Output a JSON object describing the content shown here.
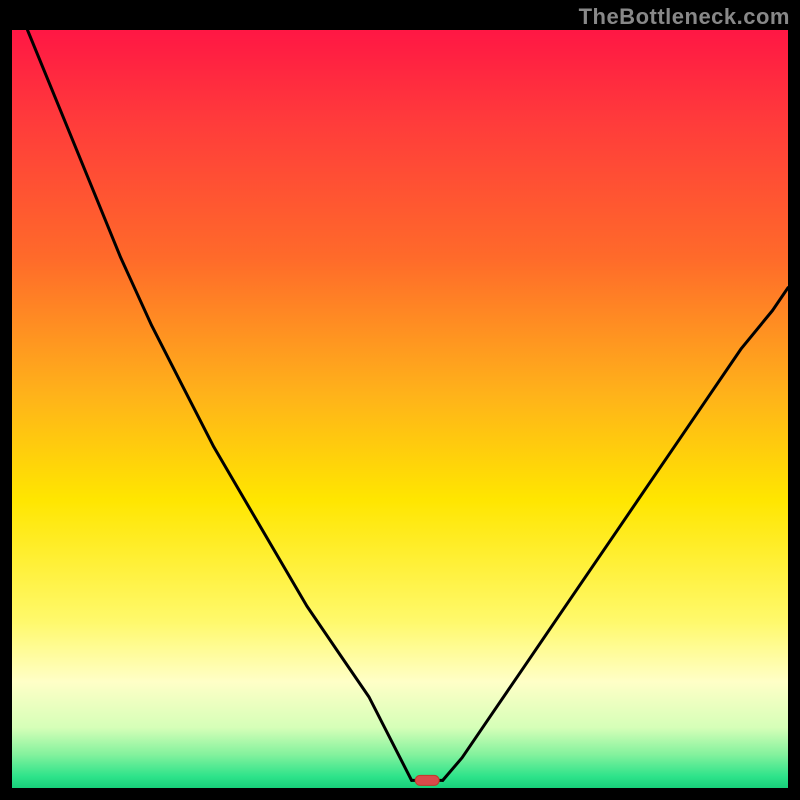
{
  "watermark": "TheBottleneck.com",
  "colors": {
    "black": "#000000",
    "curve": "#000000",
    "marker_fill": "#d94a4a",
    "marker_stroke": "#c03a2a",
    "gradient_stops": [
      {
        "offset": 0.0,
        "color": "#ff1744"
      },
      {
        "offset": 0.12,
        "color": "#ff3b3b"
      },
      {
        "offset": 0.3,
        "color": "#ff6a2a"
      },
      {
        "offset": 0.48,
        "color": "#ffb21a"
      },
      {
        "offset": 0.62,
        "color": "#ffe600"
      },
      {
        "offset": 0.78,
        "color": "#fff96b"
      },
      {
        "offset": 0.86,
        "color": "#ffffc7"
      },
      {
        "offset": 0.92,
        "color": "#d6ffb8"
      },
      {
        "offset": 0.955,
        "color": "#86f29e"
      },
      {
        "offset": 0.985,
        "color": "#2de38a"
      },
      {
        "offset": 1.0,
        "color": "#18cf7a"
      }
    ]
  },
  "chart_data": {
    "type": "line",
    "title": "",
    "xlabel": "",
    "ylabel": "",
    "xlim": [
      0,
      1
    ],
    "ylim": [
      0,
      100
    ],
    "series": [
      {
        "name": "left-branch",
        "x": [
          0.02,
          0.06,
          0.1,
          0.14,
          0.18,
          0.22,
          0.26,
          0.3,
          0.34,
          0.38,
          0.42,
          0.46,
          0.5,
          0.515
        ],
        "values": [
          100,
          90,
          80,
          70,
          61,
          53,
          45,
          38,
          31,
          24,
          18,
          12,
          4,
          1
        ]
      },
      {
        "name": "bottom-flat",
        "x": [
          0.515,
          0.555
        ],
        "values": [
          1,
          1
        ]
      },
      {
        "name": "right-branch",
        "x": [
          0.555,
          0.58,
          0.62,
          0.66,
          0.7,
          0.74,
          0.78,
          0.82,
          0.86,
          0.9,
          0.94,
          0.98,
          1.0
        ],
        "values": [
          1,
          4,
          10,
          16,
          22,
          28,
          34,
          40,
          46,
          52,
          58,
          63,
          66
        ]
      }
    ],
    "marker": {
      "x": 0.535,
      "y": 1
    }
  }
}
